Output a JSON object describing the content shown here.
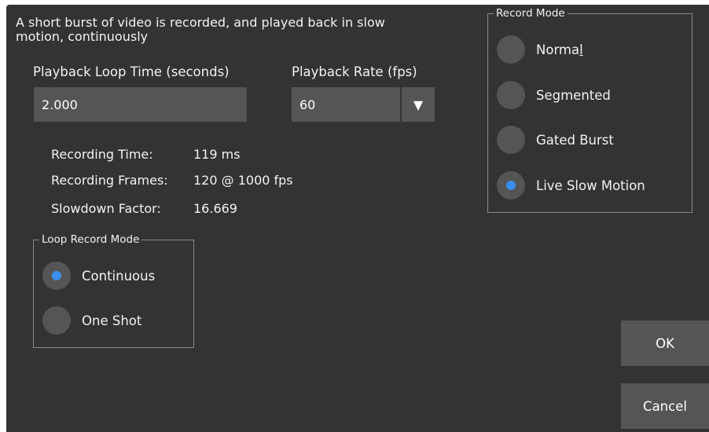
{
  "description": "A short burst of video is recorded, and played back in slow motion, continuously",
  "playback_loop_time": {
    "label": "Playback Loop Time (seconds)",
    "value": "2.000"
  },
  "playback_rate": {
    "label": "Playback Rate (fps)",
    "value": "60",
    "arrow_glyph": "▼"
  },
  "info": {
    "recording_time_label": "Recording Time:",
    "recording_time_value": "119 ms",
    "recording_frames_label": "Recording Frames:",
    "recording_frames_value": "120 @ 1000 fps",
    "slowdown_factor_label": "Slowdown Factor:",
    "slowdown_factor_value": "16.669"
  },
  "loop_record_mode": {
    "title": "Loop Record Mode",
    "options": [
      {
        "label": "Continuous",
        "selected": true
      },
      {
        "label": "One Shot",
        "selected": false
      }
    ]
  },
  "record_mode": {
    "title": "Record Mode",
    "options": [
      {
        "label_prefix": "Norma",
        "label_mnemonic": "l",
        "selected": false
      },
      {
        "label": "Segmented",
        "selected": false
      },
      {
        "label": "Gated Burst",
        "selected": false
      },
      {
        "label": "Live Slow Motion",
        "selected": true
      }
    ]
  },
  "buttons": {
    "ok": "OK",
    "cancel": "Cancel"
  },
  "colors": {
    "dialog_background": "#333333",
    "control_background": "#555555",
    "selected_dot": "#3a8ff0",
    "group_border": "#8a8a8a"
  }
}
